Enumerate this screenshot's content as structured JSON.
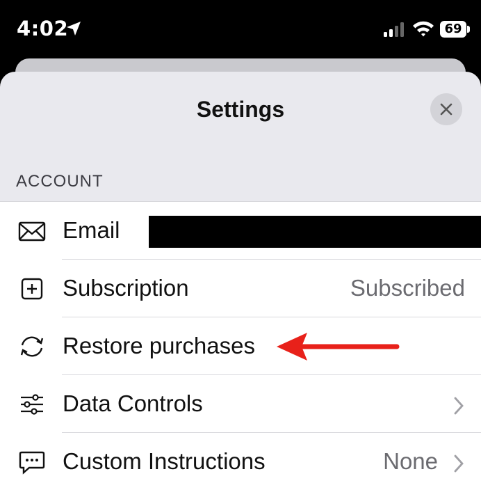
{
  "status_bar": {
    "time": "4:02",
    "battery": "69"
  },
  "sheet": {
    "title": "Settings",
    "section_header": "ACCOUNT",
    "rows": [
      {
        "label": "Email",
        "value": "",
        "icon": "envelope-icon"
      },
      {
        "label": "Subscription",
        "value": "Subscribed",
        "icon": "plus-square-icon"
      },
      {
        "label": "Restore purchases",
        "value": "",
        "icon": "refresh-icon"
      },
      {
        "label": "Data Controls",
        "value": "",
        "icon": "sliders-icon"
      },
      {
        "label": "Custom Instructions",
        "value": "None",
        "icon": "chat-bubble-icon"
      }
    ]
  },
  "annotation": {
    "type": "red-arrow",
    "color": "#e8211a",
    "points_to": "Restore purchases"
  },
  "colors": {
    "sheet_bg": "#e9e9ee",
    "list_bg": "#ffffff",
    "secondary_text": "#6b6b70"
  }
}
